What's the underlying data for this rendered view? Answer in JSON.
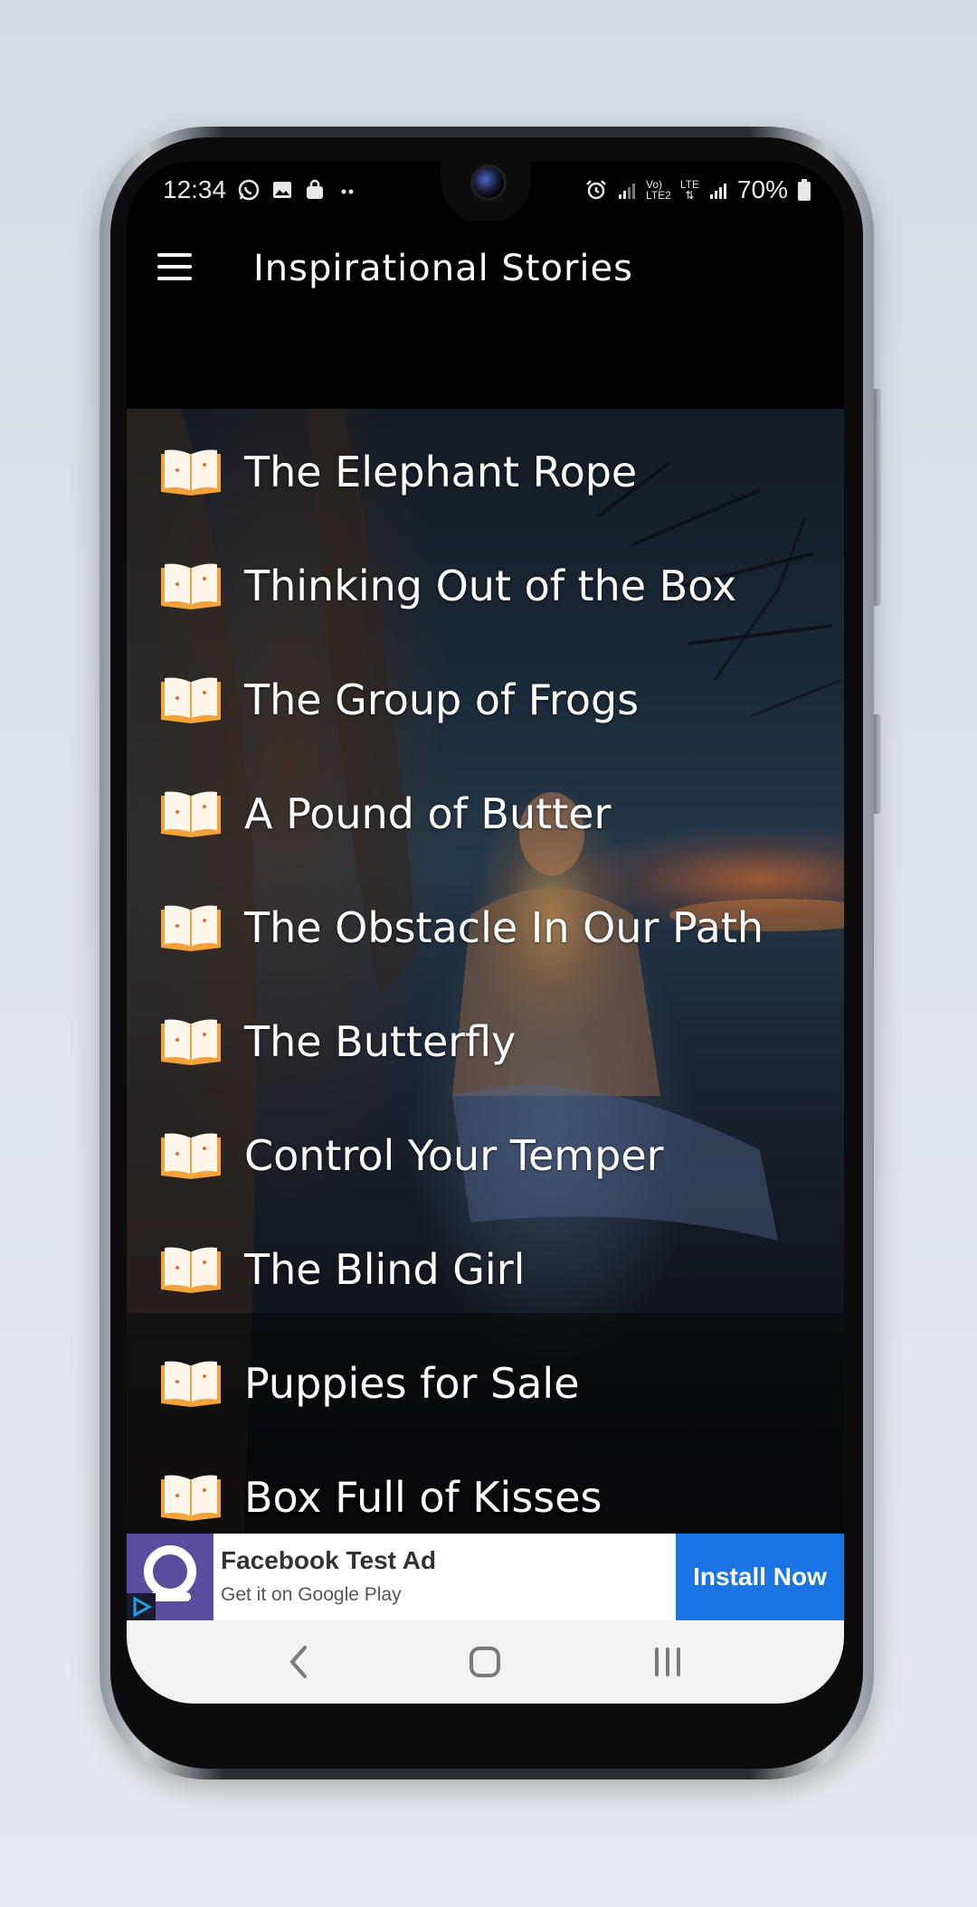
{
  "status_bar": {
    "time": "12:34",
    "network_text_1": "Vo)",
    "network_text_1b": "LTE2",
    "network_text_2": "LTE",
    "battery": "70%"
  },
  "app_bar": {
    "title": "Inspirational Stories"
  },
  "stories": [
    {
      "title": "The Elephant Rope"
    },
    {
      "title": "Thinking Out of the Box"
    },
    {
      "title": "The Group of Frogs"
    },
    {
      "title": "A Pound of Butter"
    },
    {
      "title": "The Obstacle In Our Path"
    },
    {
      "title": "The Butterfly"
    },
    {
      "title": "Control Your Temper"
    },
    {
      "title": "The Blind Girl"
    },
    {
      "title": "Puppies for Sale"
    },
    {
      "title": "Box Full of Kisses"
    }
  ],
  "ad": {
    "title": "Facebook Test Ad",
    "subtitle": "Get it on Google Play",
    "button_label": "Install Now"
  },
  "colors": {
    "ad_button": "#1b74e4",
    "ad_logo": "#5b4c9e",
    "app_bar": "#000000"
  }
}
